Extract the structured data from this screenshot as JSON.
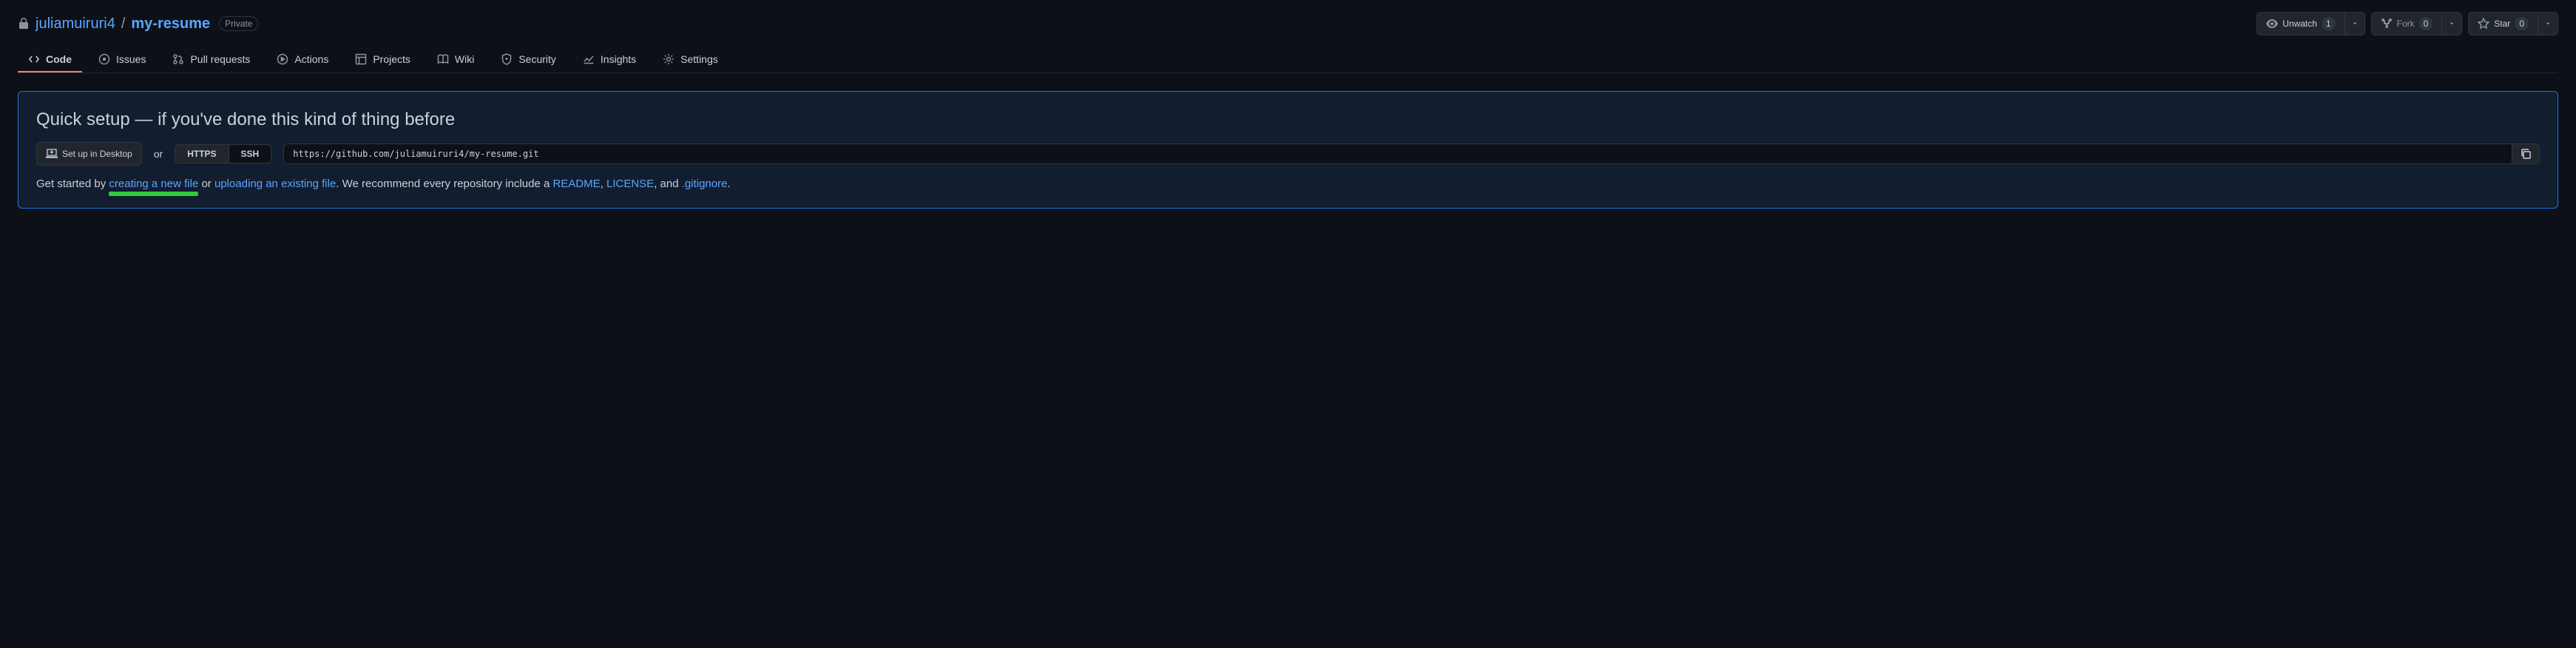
{
  "repo": {
    "owner": "juliamuiruri4",
    "name": "my-resume",
    "visibility": "Private"
  },
  "actions": {
    "unwatch": {
      "label": "Unwatch",
      "count": "1"
    },
    "fork": {
      "label": "Fork",
      "count": "0"
    },
    "star": {
      "label": "Star",
      "count": "0"
    }
  },
  "tabs": {
    "code": "Code",
    "issues": "Issues",
    "pull_requests": "Pull requests",
    "actions": "Actions",
    "projects": "Projects",
    "wiki": "Wiki",
    "security": "Security",
    "insights": "Insights",
    "settings": "Settings"
  },
  "quick_setup": {
    "heading": "Quick setup — if you've done this kind of thing before",
    "set_up_desktop": "Set up in Desktop",
    "or": "or",
    "https": "HTTPS",
    "ssh": "SSH",
    "clone_url": "https://github.com/juliamuiruri4/my-resume.git",
    "get_started_prefix": "Get started by ",
    "create_file": "creating a new file",
    "or2": " or ",
    "upload_file": "uploading an existing file",
    "recommend": ". We recommend every repository include a ",
    "readme": "README",
    "comma1": ", ",
    "license": "LICENSE",
    "comma2": ", and ",
    "gitignore": ".gitignore",
    "period": "."
  }
}
